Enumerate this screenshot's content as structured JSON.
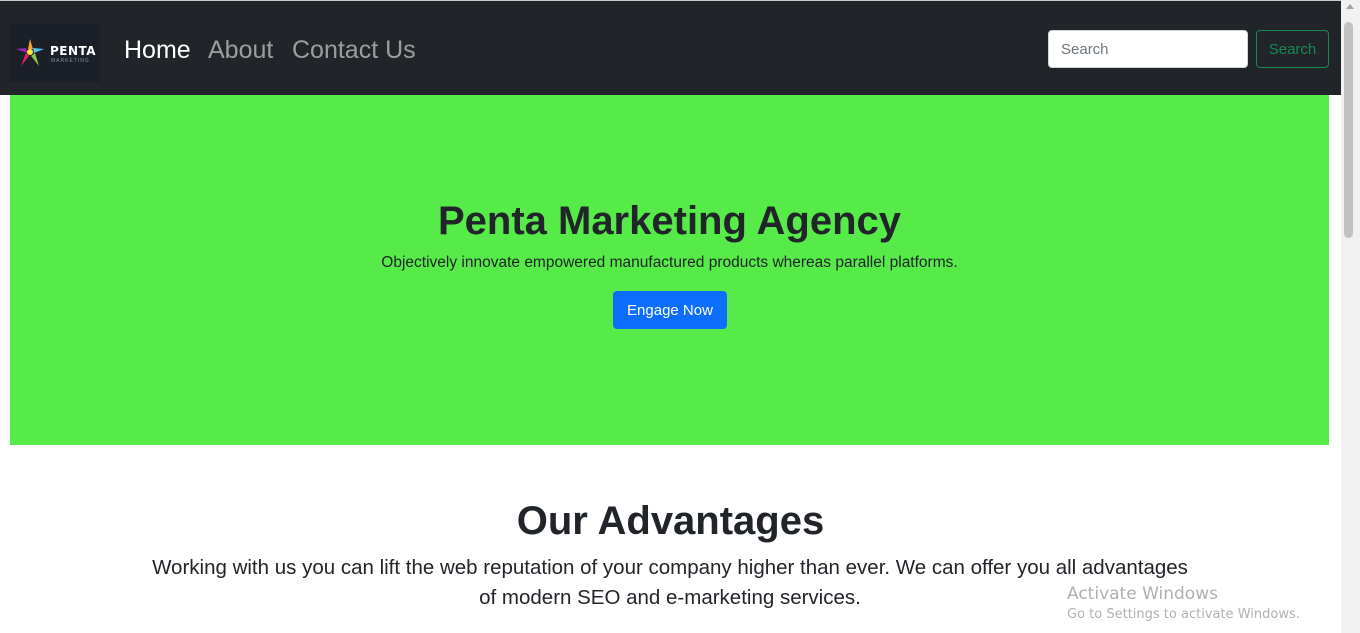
{
  "navbar": {
    "logo": {
      "word": "PENTA",
      "sub": "MARKETING",
      "icon": "star-logo-icon"
    },
    "links": [
      {
        "label": "Home",
        "active": true
      },
      {
        "label": "About",
        "active": false
      },
      {
        "label": "Contact Us",
        "active": false
      }
    ],
    "search": {
      "placeholder": "Search",
      "button_label": "Search"
    }
  },
  "hero": {
    "title": "Penta Marketing Agency",
    "text": "Objectively innovate empowered manufactured products whereas parallel platforms.",
    "button_label": "Engage Now",
    "background": "#56eb49"
  },
  "advantages": {
    "title": "Our Advantages",
    "text": "Working with us you can lift the web reputation of your company higher than ever. We can offer you all advantages of modern SEO and e-marketing services."
  },
  "watermark": {
    "title": "Activate Windows",
    "subtitle": "Go to Settings to activate Windows."
  },
  "colors": {
    "navbar": "#212529",
    "primary_button": "#0d6efd",
    "success_outline": "#198754"
  }
}
